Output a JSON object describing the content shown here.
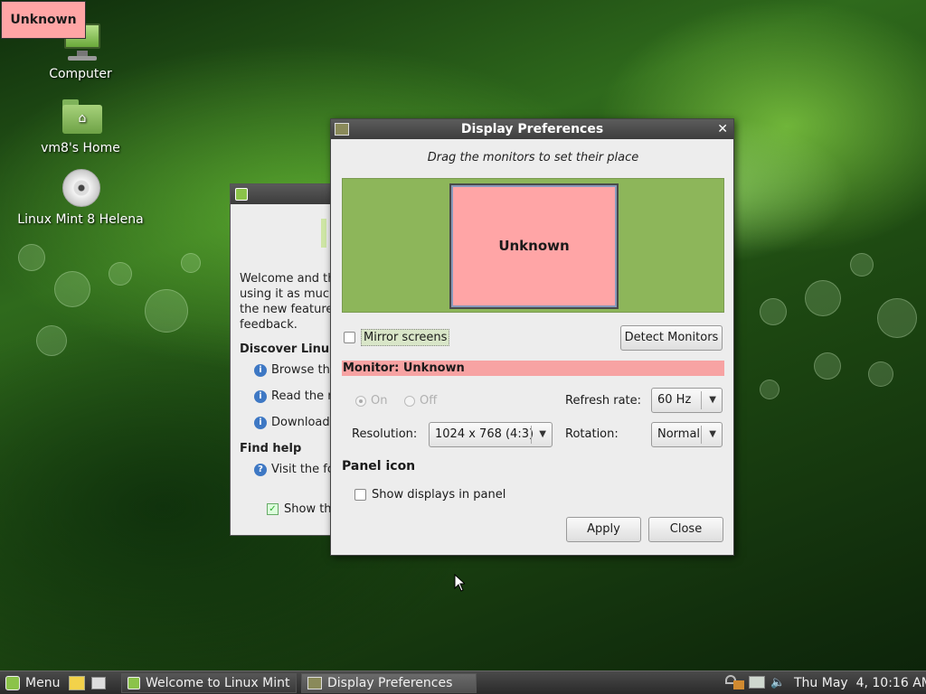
{
  "desktop": {
    "unknown_tag": "Unknown",
    "icons": [
      {
        "label": "Computer",
        "icon": "computer-icon"
      },
      {
        "label": "vm8's Home",
        "icon": "home-folder-icon"
      },
      {
        "label": "Linux Mint 8 Helena",
        "icon": "cd-icon"
      }
    ]
  },
  "welcome_window": {
    "text_lines": [
      "Welcome and th",
      "using it as muc",
      "the new feature",
      "feedback."
    ],
    "section_discover": "Discover Linu",
    "items": [
      "Browse th",
      "Read the r",
      "Download"
    ],
    "section_help": "Find help",
    "help_items": [
      "Visit the fo"
    ],
    "show_check_label": "Show th"
  },
  "dialog": {
    "title": "Display Preferences",
    "instruction": "Drag the monitors to set their place",
    "monitor_box_label": "Unknown",
    "mirror_label": "Mirror screens",
    "mirror_checked": false,
    "detect_button": "Detect Monitors",
    "monitor_banner": "Monitor: Unknown",
    "on_label": "On",
    "off_label": "Off",
    "refresh_label": "Refresh rate:",
    "refresh_value": "60 Hz",
    "resolution_label": "Resolution:",
    "resolution_value": "1024 x 768 (4:3)",
    "rotation_label": "Rotation:",
    "rotation_value": "Normal",
    "panel_icon_heading": "Panel icon",
    "show_in_panel_label": "Show displays in panel",
    "show_in_panel_checked": false,
    "apply_button": "Apply",
    "close_button": "Close"
  },
  "taskbar": {
    "menu_label": "Menu",
    "tasks": [
      {
        "label": "Welcome to Linux Mint",
        "active": false
      },
      {
        "label": "Display Preferences",
        "active": true
      }
    ],
    "clock": "Thu May  4, 10:16 AM"
  },
  "colors": {
    "monitor_fill": "#ffa5a6",
    "monitor_area_bg": "#8db65a",
    "banner_bg": "#f7a3a3"
  }
}
